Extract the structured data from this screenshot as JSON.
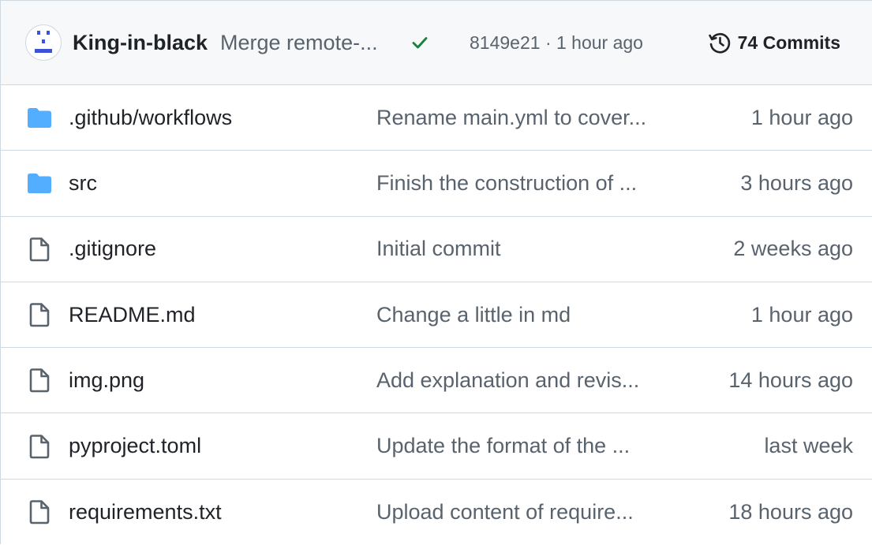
{
  "latest_commit": {
    "author": "King-in-black",
    "message": "Merge remote-...",
    "hash_time": "8149e21 · 1 hour ago",
    "commits_label": "74 Commits",
    "status": "success",
    "avatar_icon": "identicon-avatar",
    "check_icon": "check-icon",
    "history_icon": "history-icon"
  },
  "colors": {
    "folder": "#54aeff",
    "file": "#59636e",
    "check": "#1a7f37",
    "header_bg": "#f6f8fa",
    "border": "#d1d9e0",
    "avatar": "#3c52d9"
  },
  "files": [
    {
      "type": "folder",
      "icon": "folder-icon",
      "name": ".github/workflows",
      "message": "Rename main.yml to cover...",
      "time": "1 hour ago"
    },
    {
      "type": "folder",
      "icon": "folder-icon",
      "name": "src",
      "message": "Finish the construction of ...",
      "time": "3 hours ago"
    },
    {
      "type": "file",
      "icon": "file-icon",
      "name": ".gitignore",
      "message": "Initial commit",
      "time": "2 weeks ago"
    },
    {
      "type": "file",
      "icon": "file-icon",
      "name": "README.md",
      "message": "Change a little in md",
      "time": "1 hour ago"
    },
    {
      "type": "file",
      "icon": "file-icon",
      "name": "img.png",
      "message": "Add explanation and revis...",
      "time": "14 hours ago"
    },
    {
      "type": "file",
      "icon": "file-icon",
      "name": "pyproject.toml",
      "message": "Update the format of the ...",
      "time": "last week"
    },
    {
      "type": "file",
      "icon": "file-icon",
      "name": "requirements.txt",
      "message": "Upload content of require...",
      "time": "18 hours ago"
    }
  ]
}
